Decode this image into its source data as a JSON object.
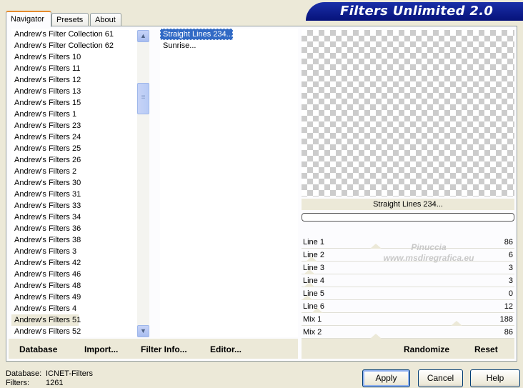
{
  "tabs": [
    "Navigator",
    "Presets",
    "About"
  ],
  "title": "Filters Unlimited 2.0",
  "categories": [
    "Andrew's Filter Collection 61",
    "Andrew's Filter Collection 62",
    "Andrew's Filters 10",
    "Andrew's Filters 11",
    "Andrew's Filters 12",
    "Andrew's Filters 13",
    "Andrew's Filters 15",
    "Andrew's Filters 1",
    "Andrew's Filters 23",
    "Andrew's Filters 24",
    "Andrew's Filters 25",
    "Andrew's Filters 26",
    "Andrew's Filters 2",
    "Andrew's Filters 30",
    "Andrew's Filters 31",
    "Andrew's Filters 33",
    "Andrew's Filters 34",
    "Andrew's Filters 36",
    "Andrew's Filters 38",
    "Andrew's Filters 3",
    "Andrew's Filters 42",
    "Andrew's Filters 46",
    "Andrew's Filters 48",
    "Andrew's Filters 49",
    "Andrew's Filters 4",
    "Andrew's Filters 51",
    "Andrew's Filters 52"
  ],
  "selected_category": "Andrew's Filters 51",
  "filters": [
    "Straight Lines 234...",
    "Sunrise..."
  ],
  "selected_filter": "Straight Lines 234...",
  "preview_name": "Straight Lines 234...",
  "watermark": [
    "Pinuccia",
    "www.msdiregrafica.eu"
  ],
  "sliders": [
    {
      "label": "Line 1",
      "value": "86",
      "level": 0.34
    },
    {
      "label": "Line 2",
      "value": "6",
      "level": 0.02
    },
    {
      "label": "Line 3",
      "value": "3",
      "level": 0.01
    },
    {
      "label": "Line 4",
      "value": "3",
      "level": 0.01
    },
    {
      "label": "Line 5",
      "value": "0",
      "level": 0.0
    },
    {
      "label": "Line 6",
      "value": "12",
      "level": 0.05
    },
    {
      "label": "Mix 1",
      "value": "188",
      "level": 0.74
    },
    {
      "label": "Mix 2",
      "value": "86",
      "level": 0.34
    }
  ],
  "toolbar": {
    "database": "Database",
    "import": "Import...",
    "filter_info": "Filter Info...",
    "editor": "Editor...",
    "randomize": "Randomize",
    "reset": "Reset"
  },
  "status": {
    "database_label": "Database:",
    "database_value": "ICNET-Filters",
    "filters_label": "Filters:",
    "filters_value": "1261"
  },
  "buttons": {
    "apply": "Apply",
    "cancel": "Cancel",
    "help": "Help"
  },
  "icons": {
    "scroll_up": "chevron-up-icon",
    "scroll_down": "chevron-down-icon",
    "scroll_grip": "grip-icon"
  },
  "colors": {
    "banner": "#0a1a8c",
    "selection": "#316ac5",
    "tab_accent": "#e68b2c"
  }
}
